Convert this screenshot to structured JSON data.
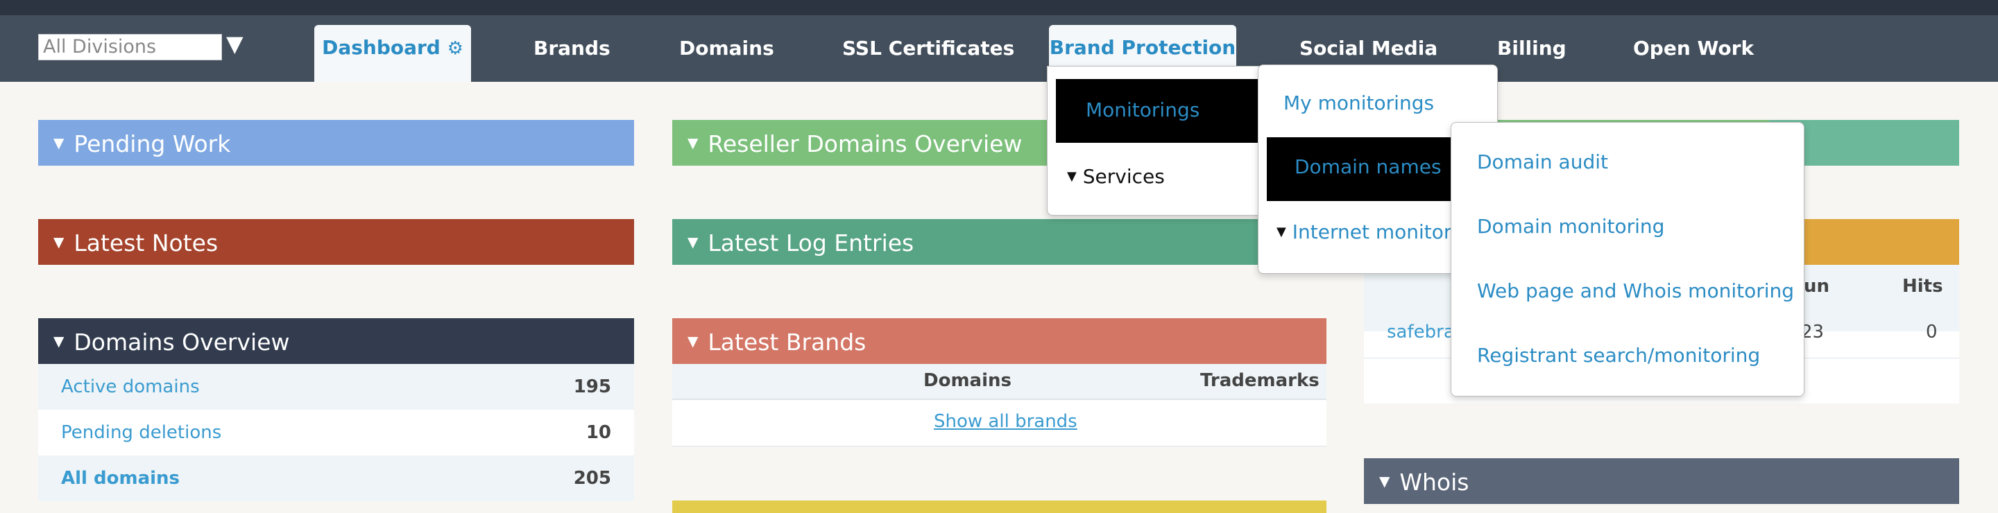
{
  "nav": {
    "division_placeholder": "All Divisions",
    "items": {
      "dashboard": "Dashboard",
      "brands": "Brands",
      "domains": "Domains",
      "ssl": "SSL Certificates",
      "brand_protection": "Brand Protection",
      "social_media": "Social Media",
      "billing": "Billing",
      "open_work": "Open Work"
    }
  },
  "panels": {
    "pending_work": "Pending Work",
    "latest_notes": "Latest Notes",
    "domains_overview": "Domains Overview",
    "reseller_domains": "Reseller Domains Overview",
    "latest_log": "Latest Log Entries",
    "latest_brands": "Latest Brands",
    "whois": "Whois"
  },
  "domains_overview": {
    "rows": [
      {
        "label": "Active domains",
        "value": "195"
      },
      {
        "label": "Pending deletions",
        "value": "10"
      },
      {
        "label": "All domains",
        "value": "205"
      }
    ]
  },
  "latest_brands": {
    "col_domains": "Domains",
    "col_trademarks": "Trademarks",
    "show_all": "Show all brands"
  },
  "right_table": {
    "col_run": "un",
    "col_hits": "Hits",
    "row_name": "safebra",
    "row_date": "23",
    "row_hits": "0"
  },
  "menus": {
    "level1": {
      "monitorings": "Monitorings",
      "services": "Services"
    },
    "level2": {
      "my_monitorings": "My monitorings",
      "domain_names": "Domain names",
      "internet_monitoring": "Internet monitori"
    },
    "level3": {
      "domain_audit": "Domain audit",
      "domain_monitoring": "Domain monitoring",
      "web_whois": "Web page and Whois monitoring",
      "registrant": "Registrant search/monitoring"
    }
  },
  "colors": {
    "navbar": "#434f5c",
    "pending_work": "#7fa8e2",
    "latest_notes": "#a5432c",
    "domains_overview": "#323c4e",
    "reseller": "#7cc07c",
    "log": "#58a585",
    "brands": "#d37665",
    "whois": "#5b6678",
    "right_orange": "#e0a63d",
    "right_teal": "#6bb89b",
    "bottom_yellow": "#e3cb4b"
  }
}
